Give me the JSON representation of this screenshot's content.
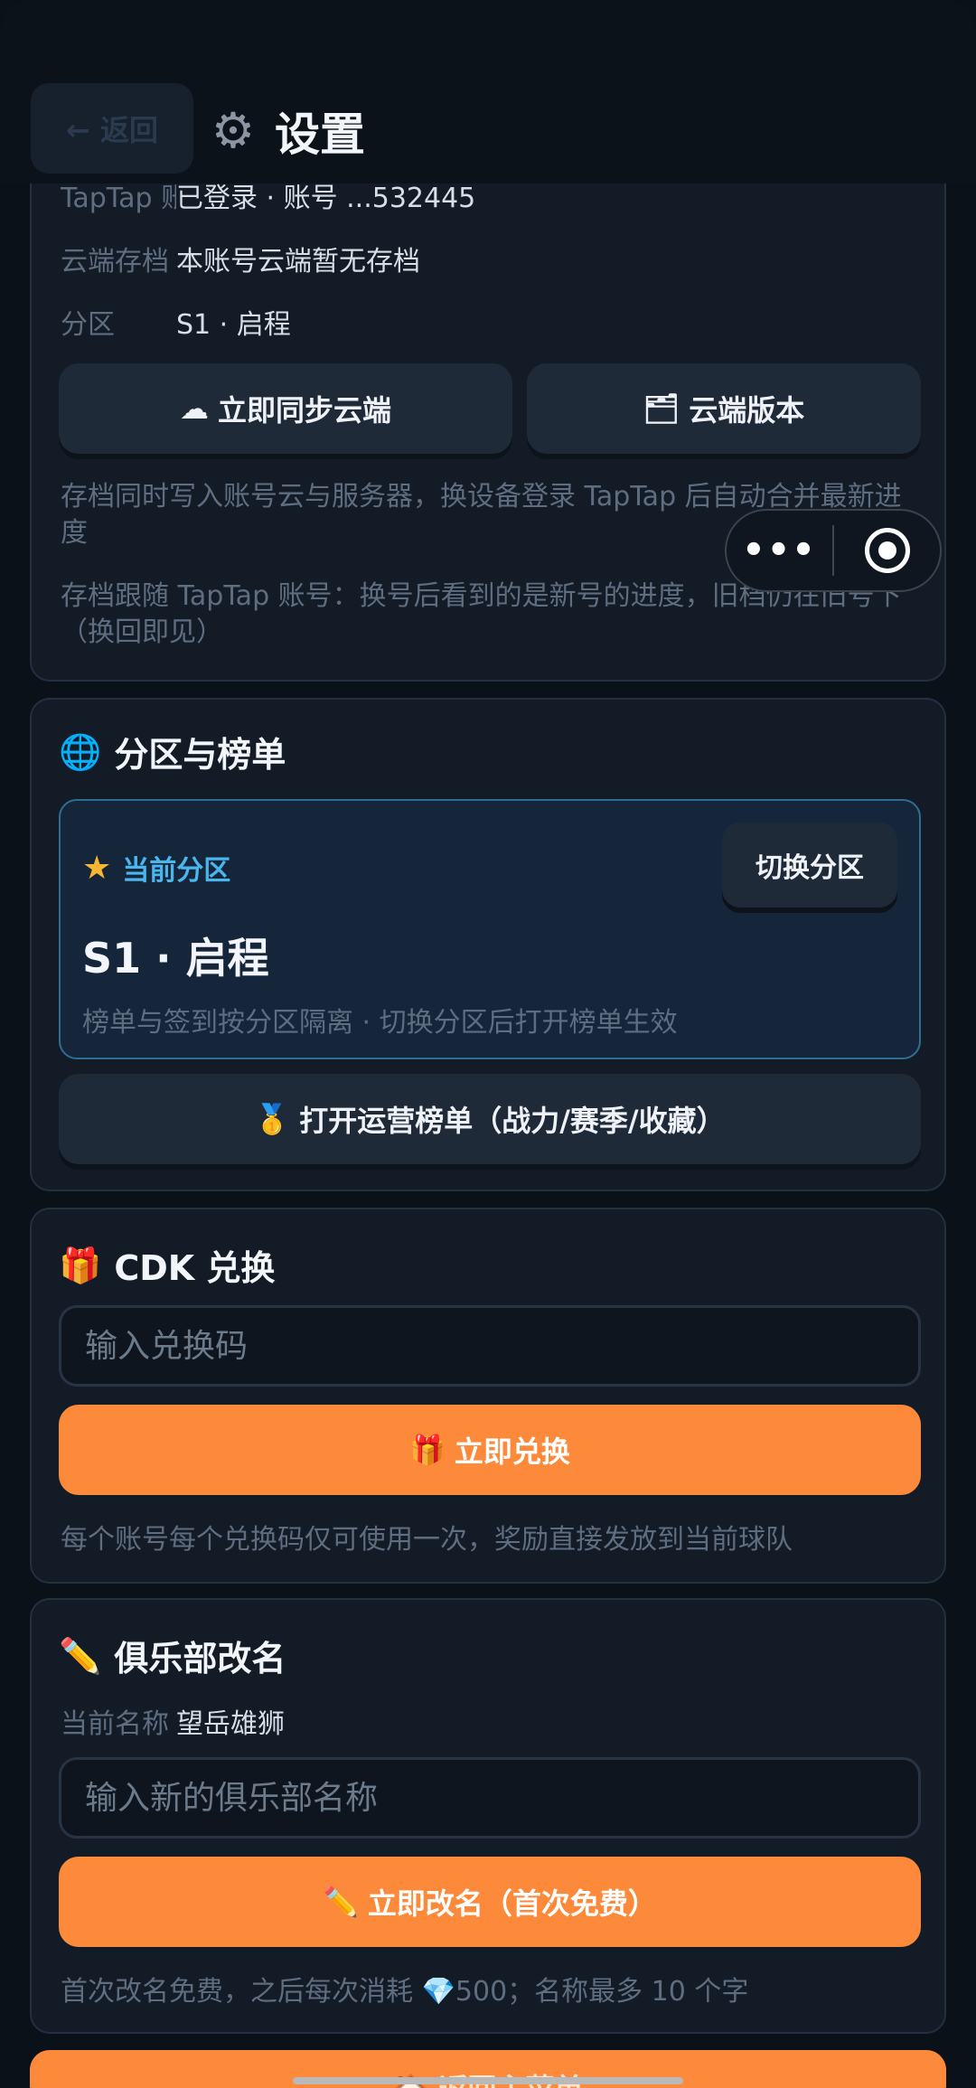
{
  "header": {
    "back_label": "← 返回",
    "title": "设置",
    "gear_icon": "gear-icon"
  },
  "capsule": {
    "more_label": "•••"
  },
  "account": {
    "taptap_key": "TapTap 账号",
    "taptap_value": "已登录 · 账号 ...532445",
    "cloud_key": "云端存档",
    "cloud_value": "本账号云端暂无存档",
    "zone_key": "分区",
    "zone_value": "S1 · 启程",
    "sync_icon": "☁",
    "sync_label": "立即同步云端",
    "version_icon": "🗂",
    "version_label": "云端版本",
    "note1": "存档同时写入账号云与服务器，换设备登录 TapTap 后自动合并最新进度",
    "note2": "存档跟随 TapTap 账号：换号后看到的是新号的进度，旧档仍在旧号下（换回即见）"
  },
  "zone": {
    "title_icon": "🌐",
    "title": "分区与榜单",
    "current_label": "当前分区",
    "switch_label": "切换分区",
    "current_name": "S1 · 启程",
    "hint": "榜单与签到按分区隔离 · 切换分区后打开榜单生效",
    "leaderboard_icon": "🥇",
    "leaderboard_label": "打开运营榜单（战力/赛季/收藏）"
  },
  "cdk": {
    "title_icon": "🎁",
    "title": "CDK 兑换",
    "placeholder": "输入兑换码",
    "redeem_icon": "🎁",
    "redeem_label": "立即兑换",
    "note": "每个账号每个兑换码仅可使用一次，奖励直接发放到当前球队"
  },
  "rename": {
    "title_icon": "✏️",
    "title": "俱乐部改名",
    "current_key": "当前名称",
    "current_value": "望岳雄狮",
    "placeholder": "输入新的俱乐部名称",
    "rename_icon": "✏️",
    "rename_label": "立即改名（首次免费）",
    "note": "首次改名免费，之后每次消耗 💎500；名称最多 10 个字"
  },
  "bottom": {
    "home_label": "🏠 返回主菜单"
  },
  "colors": {
    "accent": "#fd8a3a",
    "zone_border": "#2f6e92",
    "zone_label": "#49b6ee"
  }
}
